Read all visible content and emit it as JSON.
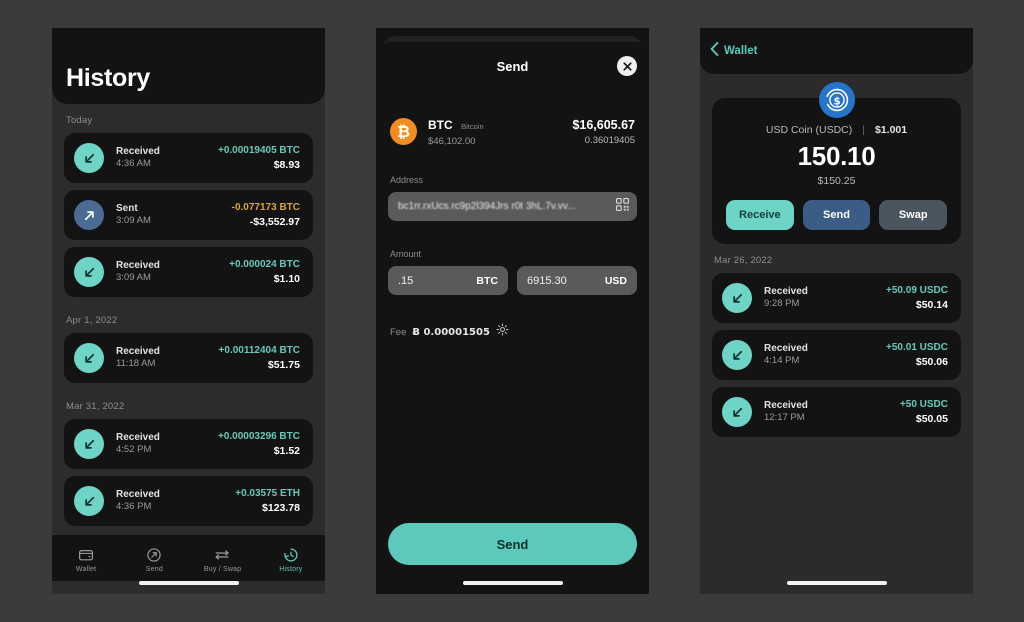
{
  "screens": {
    "history": {
      "title": "History",
      "sections": [
        {
          "date": "Today",
          "transactions": [
            {
              "icon": "arrow-down-left-icon",
              "direction": "received",
              "type": "Received",
              "time": "4:36 AM",
              "amount": "+0.00019405 BTC",
              "fiat": "$8.93",
              "sign": "pos"
            },
            {
              "icon": "arrow-up-right-icon",
              "direction": "sent",
              "type": "Sent",
              "time": "3:09 AM",
              "amount": "-0.077173 BTC",
              "fiat": "-$3,552.97",
              "sign": "neg"
            },
            {
              "icon": "arrow-down-left-icon",
              "direction": "received",
              "type": "Received",
              "time": "3:09 AM",
              "amount": "+0.000024 BTC",
              "fiat": "$1.10",
              "sign": "pos"
            }
          ]
        },
        {
          "date": "Apr 1, 2022",
          "transactions": [
            {
              "icon": "arrow-down-left-icon",
              "direction": "received",
              "type": "Received",
              "time": "11:18 AM",
              "amount": "+0.00112404 BTC",
              "fiat": "$51.75",
              "sign": "pos"
            }
          ]
        },
        {
          "date": "Mar 31, 2022",
          "transactions": [
            {
              "icon": "arrow-down-left-icon",
              "direction": "received",
              "type": "Received",
              "time": "4:52 PM",
              "amount": "+0.00003296 BTC",
              "fiat": "$1.52",
              "sign": "pos"
            },
            {
              "icon": "arrow-down-left-icon",
              "direction": "received",
              "type": "Received",
              "time": "4:36 PM",
              "amount": "+0.03575 ETH",
              "fiat": "$123.78",
              "sign": "pos"
            }
          ]
        }
      ],
      "tabbar": [
        {
          "label": "Wallet",
          "icon": "wallet-icon",
          "active": false
        },
        {
          "label": "Send",
          "icon": "send-arrow-icon",
          "active": false
        },
        {
          "label": "Buy / Swap",
          "icon": "swap-arrows-icon",
          "active": false
        },
        {
          "label": "History",
          "icon": "clock-history-icon",
          "active": true
        }
      ]
    },
    "send": {
      "title": "Send",
      "close_icon": "close-icon",
      "coin": {
        "badge_symbol": "₿",
        "symbol": "BTC",
        "name": "Bitcoin",
        "price": "$46,102.00",
        "fiat_balance": "$16,605.67",
        "quantity": "0.36019405"
      },
      "address": {
        "label": "Address",
        "value": "bc1rr.rxUcs.rc9p2l394Jrs r0t 3hL.7v.vv...",
        "qr_icon": "qr-code-icon"
      },
      "amount": {
        "label": "Amount",
        "crypto_value": ".15",
        "crypto_unit": "BTC",
        "fiat_value": "6915.30",
        "fiat_unit": "USD"
      },
      "fee": {
        "label": "Fee",
        "value": "Ƀ 0.00001505",
        "settings_icon": "gear-icon"
      },
      "cta_label": "Send"
    },
    "wallet": {
      "nav": {
        "back_icon": "chevron-left-icon",
        "label": "Wallet"
      },
      "token": {
        "badge_icon": "usdc-coin-icon",
        "name": "USD Coin (USDC)",
        "separator": "|",
        "price": "$1.001",
        "balance": "150.10",
        "fiat_balance": "$150.25"
      },
      "actions": [
        {
          "label": "Receive",
          "style": "receive"
        },
        {
          "label": "Send",
          "style": "send"
        },
        {
          "label": "Swap",
          "style": "swap"
        }
      ],
      "sections": [
        {
          "date": "Mar 26, 2022",
          "transactions": [
            {
              "icon": "arrow-down-left-icon",
              "direction": "received",
              "type": "Received",
              "time": "9:28 PM",
              "amount": "+50.09 USDC",
              "fiat": "$50.14",
              "sign": "pos"
            },
            {
              "icon": "arrow-down-left-icon",
              "direction": "received",
              "type": "Received",
              "time": "4:14 PM",
              "amount": "+50.01 USDC",
              "fiat": "$50.06",
              "sign": "pos"
            },
            {
              "icon": "arrow-down-left-icon",
              "direction": "received",
              "type": "Received",
              "time": "12:17 PM",
              "amount": "+50 USDC",
              "fiat": "$50.05",
              "sign": "pos"
            }
          ]
        }
      ]
    }
  },
  "colors": {
    "accent_teal": "#6ed4c6",
    "sent_blue": "#4a6c92",
    "btc_orange": "#f08d20",
    "usdc_blue": "#2775ca",
    "negative_amber": "#d9a440",
    "canvas": "#3b3b3b"
  }
}
